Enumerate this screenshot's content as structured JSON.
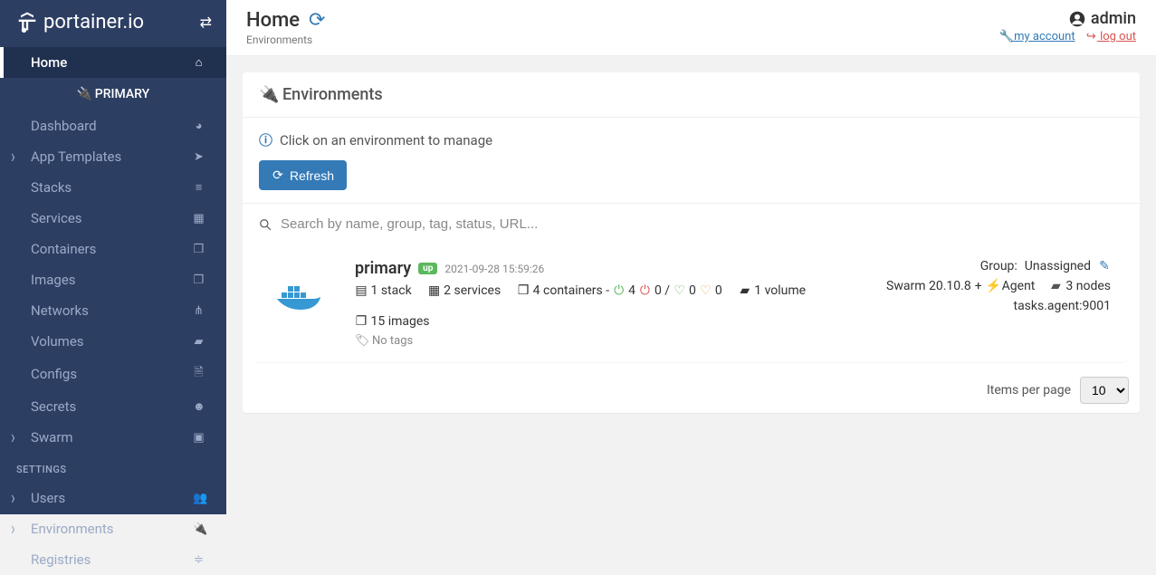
{
  "brand": "portainer.io",
  "sidebar": {
    "env_label": "PRIMARY",
    "items": [
      {
        "label": "Home",
        "icon": "home-icon",
        "active": true
      },
      {
        "label": "Dashboard",
        "icon": "tachometer-icon"
      },
      {
        "label": "App Templates",
        "icon": "rocket-icon",
        "caret": true
      },
      {
        "label": "Stacks",
        "icon": "list-icon"
      },
      {
        "label": "Services",
        "icon": "list-alt-icon"
      },
      {
        "label": "Containers",
        "icon": "cubes-icon"
      },
      {
        "label": "Images",
        "icon": "clone-icon"
      },
      {
        "label": "Networks",
        "icon": "sitemap-icon"
      },
      {
        "label": "Volumes",
        "icon": "hdd-icon"
      },
      {
        "label": "Configs",
        "icon": "file-icon"
      },
      {
        "label": "Secrets",
        "icon": "user-secret-icon"
      },
      {
        "label": "Swarm",
        "icon": "object-group-icon",
        "caret": true
      }
    ],
    "section": "SETTINGS",
    "settings_items": [
      {
        "label": "Users",
        "icon": "users-icon",
        "caret": true
      },
      {
        "label": "Environments",
        "icon": "plug-icon",
        "caret": true
      },
      {
        "label": "Registries",
        "icon": "database-icon"
      }
    ]
  },
  "header": {
    "title": "Home",
    "subtitle": "Environments",
    "user_name": "admin",
    "account_link": "my account",
    "logout_link": "log out"
  },
  "panel": {
    "title": "Environments",
    "hint": "Click on an environment to manage",
    "refresh_label": "Refresh",
    "search_placeholder": "Search by name, group, tag, status, URL..."
  },
  "env": {
    "name": "primary",
    "status": "up",
    "snapshot_time": "2021-09-28 15:59:26",
    "stacks": "1 stack",
    "services": "2 services",
    "containers_label": "4 containers -",
    "running": "4",
    "stopped": "0",
    "healthy": "0",
    "unhealthy": "0",
    "volumes": "1 volume",
    "images": "15 images",
    "tags": "No tags",
    "group_label": "Group:",
    "group_value": "Unassigned",
    "swarm": "Swarm 20.10.8",
    "agent": "Agent",
    "nodes": "3 nodes",
    "url": "tasks.agent:9001"
  },
  "pager": {
    "label": "Items per page",
    "value": "10"
  }
}
